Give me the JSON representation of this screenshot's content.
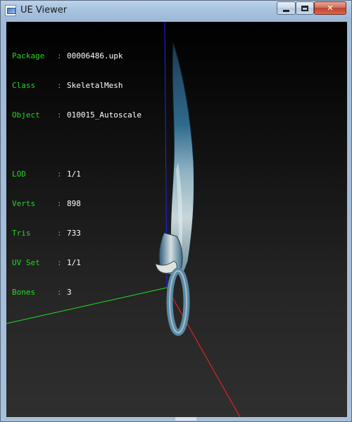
{
  "window": {
    "title": "UE Viewer",
    "buttons": {
      "minimize": "minimize",
      "maximize": "maximize",
      "close": "close"
    }
  },
  "info": {
    "package": {
      "label": "Package",
      "value": "00006486.upk"
    },
    "class": {
      "label": "Class",
      "value": "SkeletalMesh"
    },
    "object": {
      "label": "Object",
      "value": "010015_Autoscale"
    },
    "lod": {
      "label": "LOD",
      "value": "1/1"
    },
    "verts": {
      "label": "Verts",
      "value": "898"
    },
    "tris": {
      "label": "Tris",
      "value": "733"
    },
    "uvset": {
      "label": "UV Set",
      "value": "1/1"
    },
    "bones": {
      "label": "Bones",
      "value": "3"
    }
  },
  "colors": {
    "label_text": "#22d822",
    "value_text": "#ffffff",
    "axis_x": "#ff2020",
    "axis_y": "#20e020",
    "axis_z": "#2020ff"
  },
  "icons": {
    "app": "ue-viewer-app-icon"
  }
}
